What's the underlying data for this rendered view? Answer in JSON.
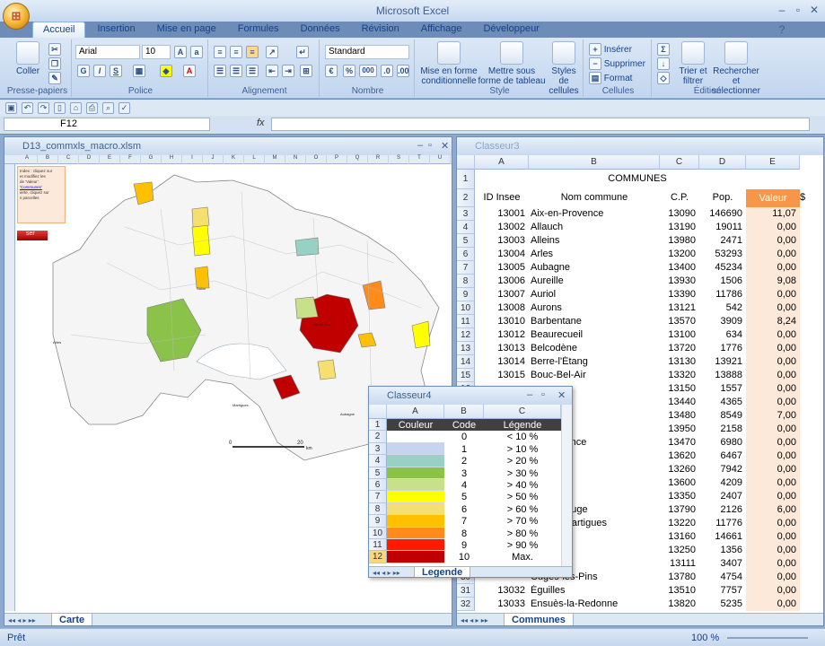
{
  "app": {
    "title": "Microsoft Excel"
  },
  "tabs": [
    "Accueil",
    "Insertion",
    "Mise en page",
    "Formules",
    "Données",
    "Révision",
    "Affichage",
    "Développeur"
  ],
  "ribbon": {
    "groups": {
      "clipboard": "Presse-papiers",
      "font": "Police",
      "alignment": "Alignement",
      "number": "Nombre",
      "style": "Style",
      "cells": "Cellules",
      "edit": "Édition"
    },
    "paste_label": "Coller",
    "font_name": "Arial",
    "font_size": "10",
    "bold": "G",
    "italic": "I",
    "underline": "S",
    "number_format": "Standard",
    "percent": "%",
    "thousands": "000",
    "cond_format": "Mise en forme conditionnelle",
    "table_format": "Mettre sous forme de tableau",
    "cell_styles": "Styles de cellules",
    "insert": "Insérer",
    "delete": "Supprimer",
    "format": "Format",
    "sort": "Trier et filtrer",
    "find": "Rechercher et sélectionner"
  },
  "formula_bar": {
    "name_box": "F12",
    "fx": "fx",
    "value": ""
  },
  "map_window": {
    "title": "D13_commxls_macro.xlsm",
    "col_letters": [
      "A",
      "B",
      "C",
      "D",
      "E",
      "F",
      "G",
      "H",
      "I",
      "J",
      "K",
      "L",
      "M",
      "N",
      "O",
      "P",
      "Q",
      "R",
      "S",
      "T",
      "U"
    ],
    "note_text": [
      "Index : cliquez sur",
      "et modifiez les",
      "de 'Valeur'.",
      "'Communes'",
      "ierte, cliquez sur",
      "s parcelles"
    ],
    "red_button": "ser",
    "scale": {
      "zero": "0",
      "twenty": "20",
      "unit": "km"
    },
    "sheet_tab": "Carte",
    "labels": [
      "Marseille",
      "Aix-en-Pce",
      "Arles",
      "Istres",
      "Martigues",
      "Salon",
      "Aubagne",
      "La Ciotat",
      "Gardanne",
      "Vitrolles"
    ]
  },
  "right_window": {
    "title": "Classeur3",
    "cols": [
      "A",
      "B",
      "C",
      "D",
      "E"
    ],
    "header_title": "COMMUNES",
    "col_headers": [
      "ID Insee",
      "Nom commune",
      "C.P.",
      "Pop.",
      "Valeur"
    ],
    "rows": [
      [
        "3",
        "13001",
        "Aix-en-Provence",
        "13090",
        "146690",
        "11,07"
      ],
      [
        "4",
        "13002",
        "Allauch",
        "13190",
        "19011",
        "0,00"
      ],
      [
        "5",
        "13003",
        "Alleins",
        "13980",
        "2471",
        "0,00"
      ],
      [
        "6",
        "13004",
        "Arles",
        "13200",
        "53293",
        "0,00"
      ],
      [
        "7",
        "13005",
        "Aubagne",
        "13400",
        "45234",
        "0,00"
      ],
      [
        "8",
        "13006",
        "Aureille",
        "13930",
        "1506",
        "9,08"
      ],
      [
        "9",
        "13007",
        "Auriol",
        "13390",
        "11786",
        "0,00"
      ],
      [
        "10",
        "13008",
        "Aurons",
        "13121",
        "542",
        "0,00"
      ],
      [
        "11",
        "13010",
        "Barbentane",
        "13570",
        "3909",
        "8,24"
      ],
      [
        "12",
        "13012",
        "Beaurecueil",
        "13100",
        "634",
        "0,00"
      ],
      [
        "13",
        "13013",
        "Belcodène",
        "13720",
        "1776",
        "0,00"
      ],
      [
        "14",
        "13014",
        "Berre-l'Étang",
        "13130",
        "13921",
        "0,00"
      ],
      [
        "15",
        "13015",
        "Bouc-Bel-Air",
        "13320",
        "13888",
        "0,00"
      ],
      [
        "16",
        "",
        "",
        "13150",
        "1557",
        "0,00"
      ],
      [
        "17",
        "",
        "",
        "13440",
        "4365",
        "0,00"
      ],
      [
        "18",
        "",
        "",
        "13480",
        "8549",
        "7,00"
      ],
      [
        "19",
        "",
        "",
        "13950",
        "2158",
        "0,00"
      ],
      [
        "20",
        "",
        "en-Provence",
        "13470",
        "6980",
        "0,00"
      ],
      [
        "21",
        "",
        "ouet",
        "13620",
        "6467",
        "0,00"
      ],
      [
        "22",
        "",
        "",
        "13260",
        "7942",
        "0,00"
      ],
      [
        "23",
        "",
        "",
        "13600",
        "4209",
        "0,00"
      ],
      [
        "24",
        "",
        "",
        "13350",
        "2407",
        "0,00"
      ],
      [
        "25",
        "",
        "euf-le-Rouge",
        "13790",
        "2126",
        "6,00"
      ],
      [
        "26",
        "",
        "euf-les-Martigues",
        "13220",
        "11776",
        "0,00"
      ],
      [
        "27",
        "",
        "enard",
        "13160",
        "14661",
        "0,00"
      ],
      [
        "28",
        "",
        "Confoux",
        "13250",
        "1356",
        "0,00"
      ],
      [
        "29",
        "",
        "",
        "13111",
        "3407",
        "0,00"
      ],
      [
        "30",
        "",
        "Cuges-les-Pins",
        "13780",
        "4754",
        "0,00"
      ],
      [
        "31",
        "13032",
        "Éguilles",
        "13510",
        "7757",
        "0,00"
      ],
      [
        "32",
        "13033",
        "Ensuès-la-Redonne",
        "13820",
        "5235",
        "0,00"
      ]
    ],
    "sheet_tab": "Communes",
    "col_f_hint": "$"
  },
  "legend_window": {
    "title": "Classeur4",
    "cols": [
      "A",
      "B",
      "C"
    ],
    "headers": [
      "Couleur",
      "Code",
      "Légende"
    ],
    "rows": [
      {
        "row": "2",
        "code": "0",
        "label": "< 10 %",
        "color": "#ffffff"
      },
      {
        "row": "3",
        "code": "1",
        "label": "> 10 %",
        "color": "#c6d4f0"
      },
      {
        "row": "4",
        "code": "2",
        "label": "> 20 %",
        "color": "#96d2c3"
      },
      {
        "row": "5",
        "code": "3",
        "label": "> 30 %",
        "color": "#8bc34a"
      },
      {
        "row": "6",
        "code": "4",
        "label": "> 40 %",
        "color": "#c9e08a"
      },
      {
        "row": "7",
        "code": "5",
        "label": "> 50 %",
        "color": "#ffff00"
      },
      {
        "row": "8",
        "code": "6",
        "label": "> 60 %",
        "color": "#f5df6e"
      },
      {
        "row": "9",
        "code": "7",
        "label": "> 70 %",
        "color": "#ffc000"
      },
      {
        "row": "10",
        "code": "8",
        "label": "> 80 %",
        "color": "#ff8c1a"
      },
      {
        "row": "11",
        "code": "9",
        "label": "> 90 %",
        "color": "#ff1a00"
      },
      {
        "row": "12",
        "code": "10",
        "label": "Max.",
        "color": "#c00000"
      }
    ],
    "sheet_tab": "Legende"
  },
  "status": {
    "ready": "Prêt",
    "zoom": "100 %"
  }
}
